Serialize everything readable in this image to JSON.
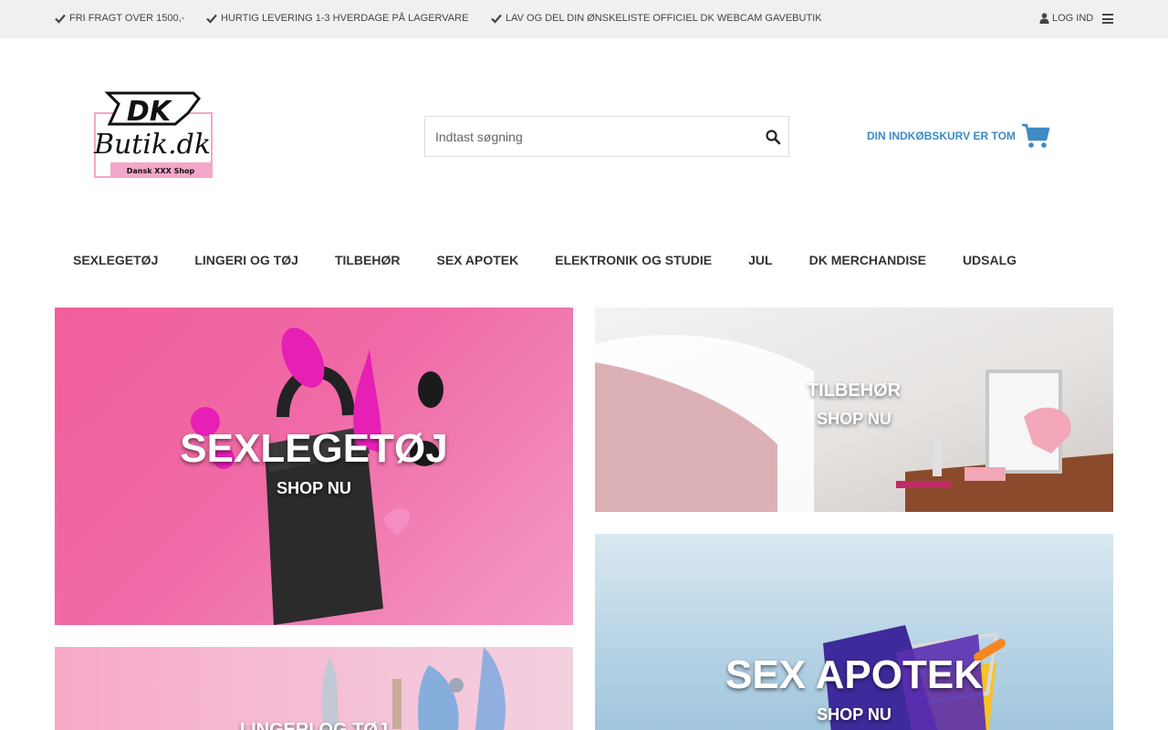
{
  "topbar": {
    "usps": [
      "FRI FRAGT OVER 1500,-",
      "HURTIG LEVERING 1-3 HVERDAGE PÅ LAGERVARE",
      "LAV OG DEL DIN ØNSKELISTE OFFICIEL DK WEBCAM GAVEBUTIK"
    ],
    "login_label": "LOG IND"
  },
  "logo": {
    "mark": "DK",
    "name": "Butik.dk",
    "tagline": "Dansk XXX Shop"
  },
  "search": {
    "placeholder": "Indtast søgning"
  },
  "cart": {
    "label": "DIN INDKØBSKURV ER TOM"
  },
  "nav": {
    "items": [
      "SEXLEGETØJ",
      "LINGERI OG TØJ",
      "TILBEHØR",
      "SEX APOTEK",
      "ELEKTRONIK OG STUDIE",
      "JUL",
      "DK MERCHANDISE",
      "UDSALG"
    ]
  },
  "tiles": [
    {
      "title": "SEXLEGETØJ",
      "cta": "SHOP NU"
    },
    {
      "title": "TILBEHØR",
      "cta": "SHOP NU"
    },
    {
      "title": "LINGERI OG TØJ",
      "cta": ""
    },
    {
      "title": "SEX APOTEK",
      "cta": "SHOP NU"
    }
  ],
  "colors": {
    "accent": "#3e8ac4",
    "topbar_bg": "#f0f0f0",
    "logo_pink": "#f4a6c8"
  },
  "icons": {
    "check": "check-icon",
    "user": "user-icon",
    "menu": "hamburger-menu-icon",
    "search": "search-icon",
    "cart": "shopping-cart-icon"
  }
}
